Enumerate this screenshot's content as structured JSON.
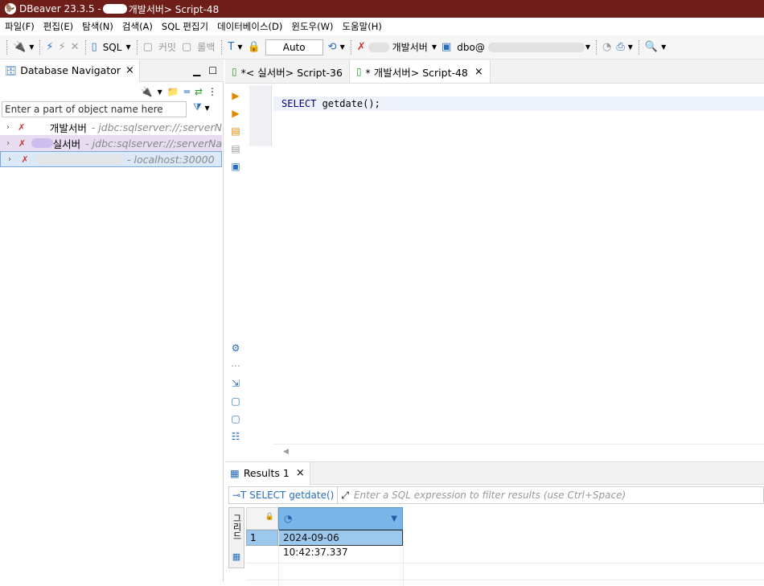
{
  "title": {
    "app": "DBeaver 23.3.5 -",
    "suffix": "개발서버> Script-48"
  },
  "menu": [
    "파일(F)",
    "편집(E)",
    "탐색(N)",
    "검색(A)",
    "SQL 편집기",
    "데이터베이스(D)",
    "윈도우(W)",
    "도움말(H)"
  ],
  "toolbar": {
    "sql": "SQL",
    "commit": "커밋",
    "rollback": "롤백",
    "tx_mode": "Auto",
    "datasource": "개발서버",
    "schema": "dbo@"
  },
  "navigator": {
    "tab_label": "Database Navigator",
    "filter_placeholder": "Enter a part of object name here",
    "items": [
      {
        "name": "개발서버",
        "url": "- jdbc:sqlserver://;serverN"
      },
      {
        "name": "실서버",
        "url": "- jdbc:sqlserver://;serverNa"
      },
      {
        "name": "",
        "url": "- localhost:30000"
      }
    ]
  },
  "editor": {
    "tabs": [
      {
        "label": "*<    실서버> Script-36",
        "active": false
      },
      {
        "label": "*      개발서버> Script-48",
        "active": true
      }
    ],
    "code": {
      "keyword": "SELECT",
      "rest": " getdate();"
    }
  },
  "results": {
    "tab_label": "Results 1",
    "query_label": "SELECT getdate()",
    "filter_placeholder": "Enter a SQL expression to filter results (use Ctrl+Space)",
    "side_label": "그리드",
    "row_number": "1",
    "cell_value": "2024-09-06 10:42:37.337"
  },
  "colors": {
    "titlebar": "#6e1d19",
    "selection": "#9cc8ee",
    "keyword": "#000080"
  }
}
